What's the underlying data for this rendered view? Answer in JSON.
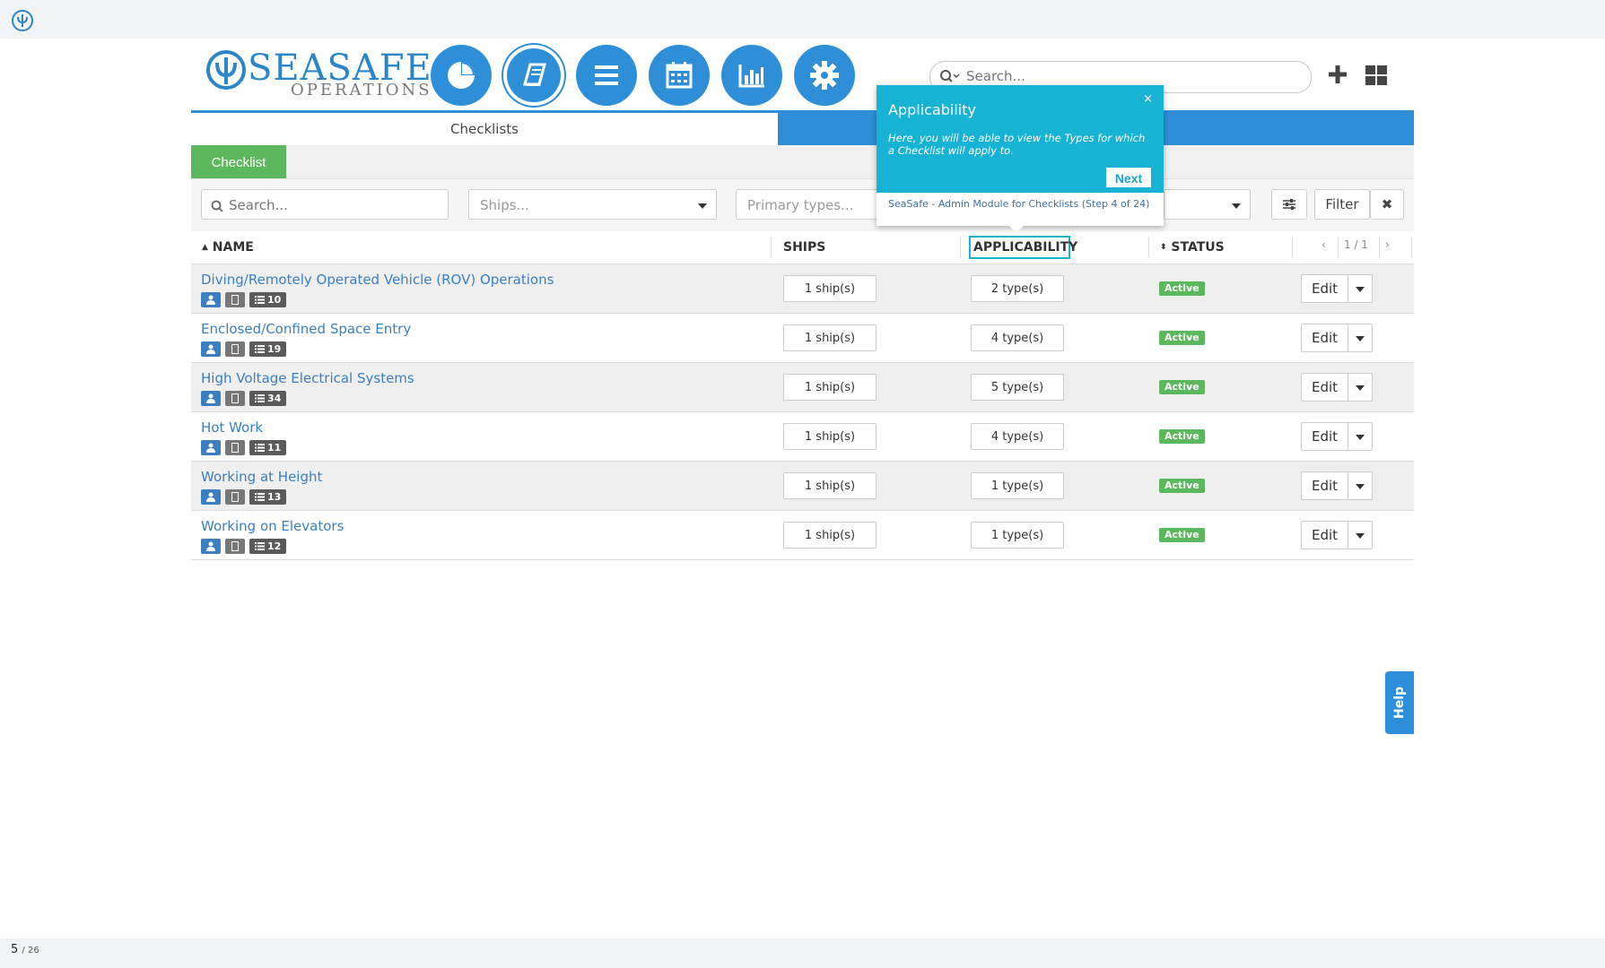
{
  "app": {
    "logo_text": "SEASAFE",
    "logo_sub": "OPERATIONS",
    "search_placeholder": "Search...",
    "tab_active": "Checklists",
    "page_button": "Checklist",
    "bottom_page": "5",
    "bottom_total": "/ 26",
    "help_label": "Help",
    "colors": {
      "brand": "#2e8fd8",
      "success": "#5cb85c",
      "tour": "#17b3d5"
    }
  },
  "nav_icons": [
    "pie-chart-icon",
    "book-icon",
    "menu-icon",
    "calendar-icon",
    "bar-chart-icon",
    "gear-icon"
  ],
  "filters": {
    "search_placeholder": "Search...",
    "ships_placeholder": "Ships...",
    "primary_types_placeholder": "Primary types...",
    "filter_label": "Filter",
    "clear_label": "✖"
  },
  "table": {
    "headers": {
      "name": "NAME",
      "ships": "SHIPS",
      "applicability": "APPLICABILITY",
      "status": "STATUS"
    },
    "pagination": "1 / 1",
    "rows": [
      {
        "name": "Diving/Remotely Operated Vehicle (ROV) Operations",
        "count": "10",
        "ships": "1 ship(s)",
        "types": "2 type(s)",
        "status": "Active",
        "edit": "Edit"
      },
      {
        "name": "Enclosed/Confined Space Entry",
        "count": "19",
        "ships": "1 ship(s)",
        "types": "4 type(s)",
        "status": "Active",
        "edit": "Edit"
      },
      {
        "name": "High Voltage Electrical Systems",
        "count": "34",
        "ships": "1 ship(s)",
        "types": "5 type(s)",
        "status": "Active",
        "edit": "Edit"
      },
      {
        "name": "Hot Work",
        "count": "11",
        "ships": "1 ship(s)",
        "types": "4 type(s)",
        "status": "Active",
        "edit": "Edit"
      },
      {
        "name": "Working at Height",
        "count": "13",
        "ships": "1 ship(s)",
        "types": "1 type(s)",
        "status": "Active",
        "edit": "Edit"
      },
      {
        "name": "Working on Elevators",
        "count": "12",
        "ships": "1 ship(s)",
        "types": "1 type(s)",
        "status": "Active",
        "edit": "Edit"
      }
    ]
  },
  "tour": {
    "title": "Applicability",
    "body": "Here, you will be able to view the Types for which a Checklist will apply to.",
    "next": "Next",
    "close": "×",
    "footer": "SeaSafe - Admin Module for Checklists (Step 4 of 24)"
  }
}
